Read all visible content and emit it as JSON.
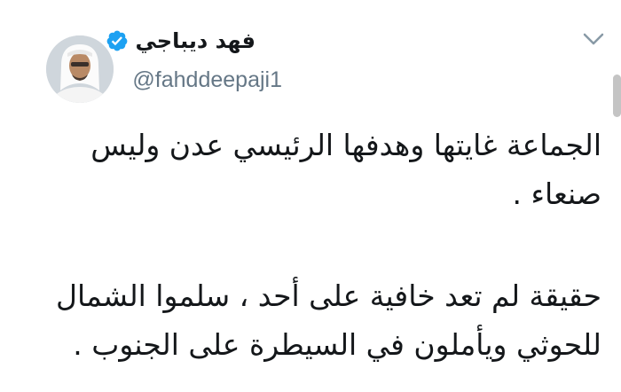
{
  "tweet": {
    "author": {
      "display_name": "فهد ديباجي",
      "handle": "@fahddeepaji1",
      "verified": true,
      "avatar_icon": "profile-photo"
    },
    "menu_icon": "chevron-down-icon",
    "text_lines": [
      "الجماعة غايتها وهدفها الرئيسي عدن وليس",
      "صنعاء .",
      "حقيقة لم تعد خافية على أحد ، سلموا الشمال",
      "للحوثي ويأملون في السيطرة على الجنوب ."
    ]
  },
  "colors": {
    "text": "#14171a",
    "secondary_text": "#657786",
    "verified_badge": "#1da1f2",
    "chevron": "#8899a6"
  }
}
